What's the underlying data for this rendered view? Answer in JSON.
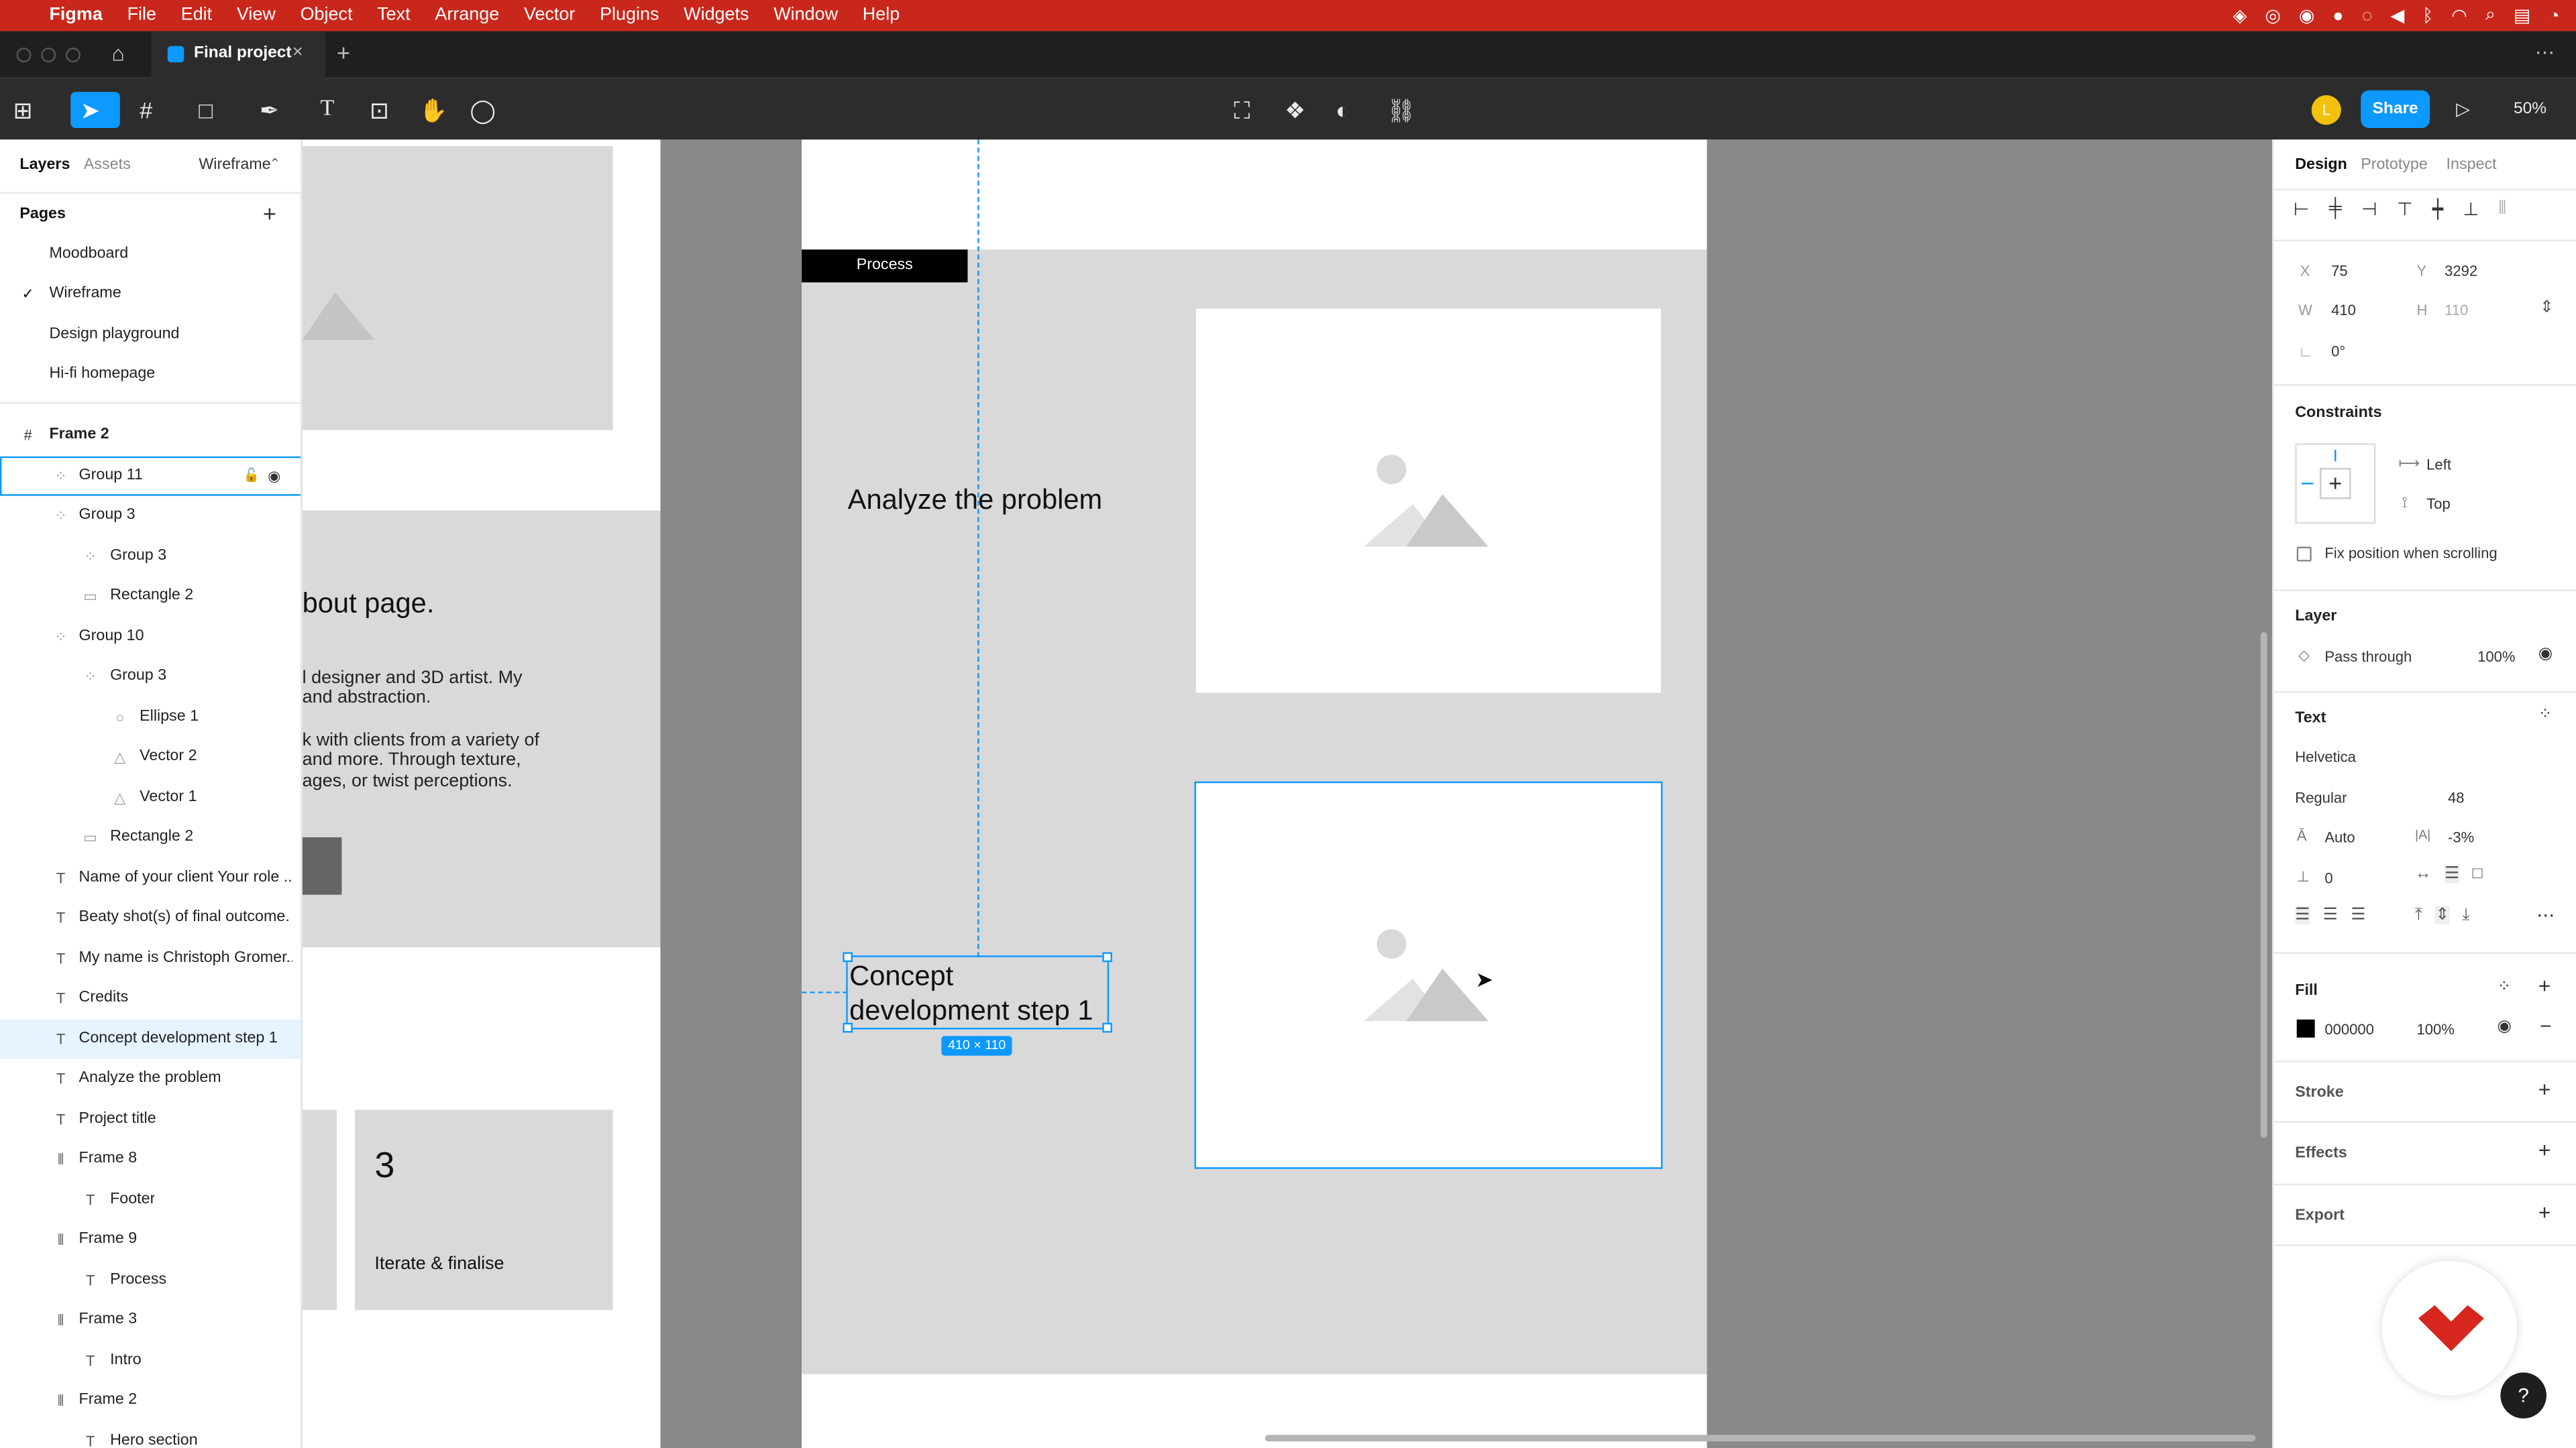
{
  "menubar": {
    "brand": "Figma",
    "items": [
      "File",
      "Edit",
      "View",
      "Object",
      "Text",
      "Arrange",
      "Vector",
      "Plugins",
      "Widgets",
      "Window",
      "Help"
    ]
  },
  "tab": {
    "title": "Final project"
  },
  "toolbar": {
    "avatar_initial": "L",
    "share_label": "Share",
    "zoom": "50%"
  },
  "left_panel": {
    "tabs": {
      "layers": "Layers",
      "assets": "Assets",
      "page_selector": "Wireframe"
    },
    "pages_heading": "Pages",
    "pages": [
      "Moodboard",
      "Wireframe",
      "Design playground",
      "Hi-fi homepage"
    ],
    "layers": [
      {
        "name": "Frame 2",
        "icon": "frame"
      },
      {
        "name": "Group 11",
        "icon": "group"
      },
      {
        "name": "Group 3",
        "icon": "group"
      },
      {
        "name": "Group 3",
        "icon": "group"
      },
      {
        "name": "Rectangle 2",
        "icon": "rect"
      },
      {
        "name": "Group 10",
        "icon": "group"
      },
      {
        "name": "Group 3",
        "icon": "group"
      },
      {
        "name": "Ellipse 1",
        "icon": "ellipse"
      },
      {
        "name": "Vector 2",
        "icon": "vector"
      },
      {
        "name": "Vector 1",
        "icon": "vector"
      },
      {
        "name": "Rectangle 2",
        "icon": "rect"
      },
      {
        "name": "Name of your client Your role ...",
        "icon": "text"
      },
      {
        "name": "Beaty shot(s) of final outcome.",
        "icon": "text"
      },
      {
        "name": "My name is Christoph Gromer....",
        "icon": "text"
      },
      {
        "name": "Credits",
        "icon": "text"
      },
      {
        "name": "Concept development step 1",
        "icon": "text"
      },
      {
        "name": "Analyze the problem",
        "icon": "text"
      },
      {
        "name": "Project title",
        "icon": "text"
      },
      {
        "name": "Frame 8",
        "icon": "autolayout"
      },
      {
        "name": "Footer",
        "icon": "text"
      },
      {
        "name": "Frame 9",
        "icon": "autolayout"
      },
      {
        "name": "Process",
        "icon": "text"
      },
      {
        "name": "Frame 3",
        "icon": "autolayout"
      },
      {
        "name": "Intro",
        "icon": "text"
      },
      {
        "name": "Frame 2",
        "icon": "autolayout"
      },
      {
        "name": "Hero section",
        "icon": "text"
      }
    ]
  },
  "canvas": {
    "about_heading": "bout page.",
    "about_line1": "l designer and 3D artist. My",
    "about_line2": "and abstraction.",
    "about_line3": "k with clients from a variety of",
    "about_line4": "and more. Through texture,",
    "about_line5": "ages, or twist perceptions.",
    "step_number": "3",
    "step_label": "Iterate & finalise",
    "process_label": "Process",
    "analyze_text": "Analyze the problem",
    "concept_line1": "Concept",
    "concept_line2": "development step 1",
    "size_badge": "410 × 110"
  },
  "right_panel": {
    "tabs": {
      "design": "Design",
      "prototype": "Prototype",
      "inspect": "Inspect"
    },
    "x_label": "X",
    "x_value": "75",
    "y_label": "Y",
    "y_value": "3292",
    "w_label": "W",
    "w_value": "410",
    "h_label": "H",
    "h_value": "110",
    "rotation": "0°",
    "constraints_heading": "Constraints",
    "constraint_h": "Left",
    "constraint_v": "Top",
    "fix_position": "Fix position when scrolling",
    "layer_heading": "Layer",
    "blend_mode": "Pass through",
    "layer_opacity": "100%",
    "text_heading": "Text",
    "font_family": "Helvetica",
    "font_weight": "Regular",
    "font_size": "48",
    "line_height": "Auto",
    "letter_spacing": "-3%",
    "paragraph_spacing": "0",
    "fill_heading": "Fill",
    "fill_hex": "000000",
    "fill_opacity": "100%",
    "stroke_heading": "Stroke",
    "effects_heading": "Effects",
    "export_heading": "Export",
    "help": "?"
  },
  "colors": {
    "menubar": "#c9271c",
    "accent": "#0d99ff",
    "canvas": "#898989"
  }
}
